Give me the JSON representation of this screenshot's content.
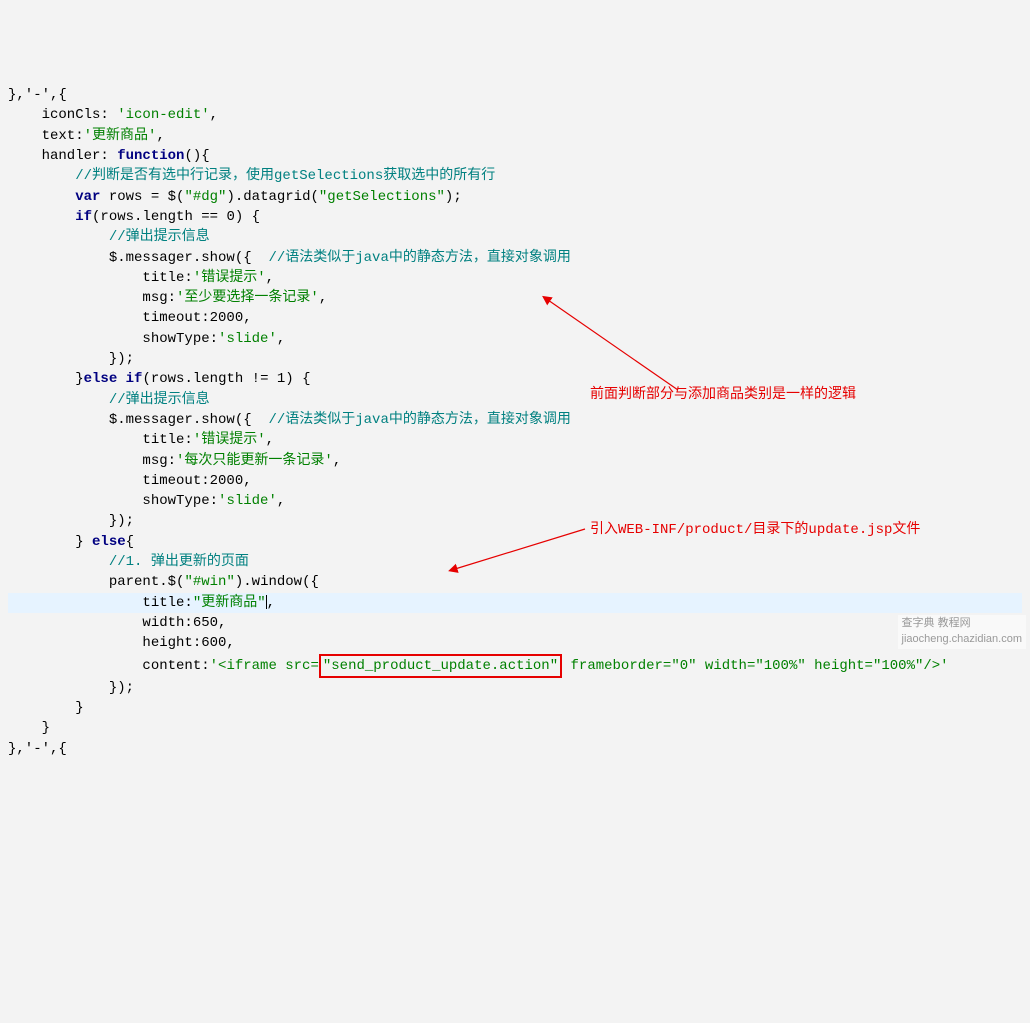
{
  "code": {
    "l1": "},'-',{",
    "l2_pre": "    iconCls: ",
    "l2_str": "'icon-edit'",
    "l2_post": ",",
    "l3_pre": "    text:",
    "l3_str": "'更新商品'",
    "l3_post": ",",
    "l4_pre": "    handler: ",
    "l4_kw": "function",
    "l4_post": "(){",
    "l5_cmt": "        //判断是否有选中行记录，使用getSelections获取选中的所有行",
    "l6_pre": "        ",
    "l6_kw": "var",
    "l6_mid": " rows = $(",
    "l6_str1": "\"#dg\"",
    "l6_mid2": ").datagrid(",
    "l6_str2": "\"getSelections\"",
    "l6_post": ");",
    "l7_pre": "        ",
    "l7_kw": "if",
    "l7_post": "(rows.length == 0) {",
    "l8_cmt": "            //弹出提示信息",
    "l9_pre": "            $.messager.show({  ",
    "l9_cmt": "//语法类似于java中的静态方法，直接对象调用",
    "l10_pre": "                title:",
    "l10_str": "'错误提示'",
    "l10_post": ",",
    "l11_pre": "                msg:",
    "l11_str": "'至少要选择一条记录'",
    "l11_post": ",",
    "l12": "                timeout:2000,",
    "l13_pre": "                showType:",
    "l13_str": "'slide'",
    "l13_post": ",",
    "l14": "            });",
    "l15_pre": "        }",
    "l15_kw1": "else",
    "l15_kw2": "if",
    "l15_post": "(rows.length != 1) {",
    "l16_cmt": "            //弹出提示信息",
    "l17_pre": "            $.messager.show({  ",
    "l17_cmt": "//语法类似于java中的静态方法，直接对象调用",
    "l18_pre": "                title:",
    "l18_str": "'错误提示'",
    "l18_post": ",",
    "l19_pre": "                msg:",
    "l19_str": "'每次只能更新一条记录'",
    "l19_post": ",",
    "l20": "                timeout:2000,",
    "l21_pre": "                showType:",
    "l21_str": "'slide'",
    "l21_post": ",",
    "l22": "            });",
    "l23_pre": "        } ",
    "l23_kw": "else",
    "l23_post": "{",
    "l24_cmt": "            //1. 弹出更新的页面",
    "l25_pre": "            parent.$(",
    "l25_str": "\"#win\"",
    "l25_post": ").window({",
    "l26_pre": "                title:",
    "l26_str": "\"更新商品\"",
    "l26_post": ",",
    "l27": "                width:650,",
    "l28": "                height:600,",
    "l29_pre": "                content:",
    "l29_s1": "'<iframe src=",
    "l29_box": "\"send_product_update.action\"",
    "l29_s2": " frameborder=\"0\" width=\"100%\" height=\"100%\"/>'",
    "l30": "            });",
    "l31": "        }",
    "l32": "    }",
    "l33": "},'-',{"
  },
  "annotations": {
    "a1": "前面判断部分与添加商品类别是一样的逻辑",
    "a2": "引入WEB-INF/product/目录下的update.jsp文件"
  },
  "watermark": "查字典 教程网\njiaocheng.chazidian.com",
  "colors": {
    "keyword": "#000080",
    "string": "#008000",
    "comment": "#008080",
    "annotation": "#e60000"
  }
}
